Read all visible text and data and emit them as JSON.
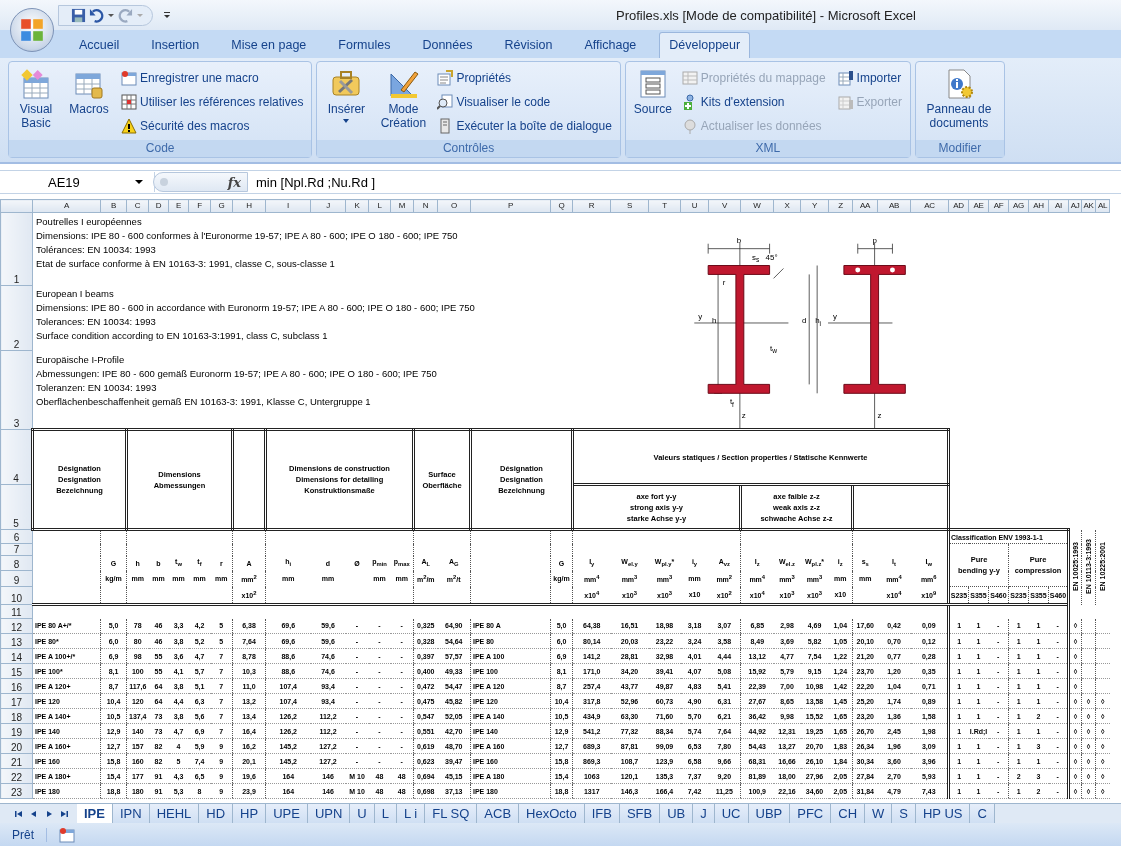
{
  "window": {
    "title": "Profiles.xls  [Mode de compatibilité] - Microsoft Excel"
  },
  "ribbon_tabs": [
    {
      "label": "Accueil",
      "selected": false
    },
    {
      "label": "Insertion",
      "selected": false
    },
    {
      "label": "Mise en page",
      "selected": false
    },
    {
      "label": "Formules",
      "selected": false
    },
    {
      "label": "Données",
      "selected": false
    },
    {
      "label": "Révision",
      "selected": false
    },
    {
      "label": "Affichage",
      "selected": false
    },
    {
      "label": "Développeur",
      "selected": true
    }
  ],
  "ribbon_groups": [
    {
      "title": "Code",
      "large": [
        {
          "label": "Visual Basic",
          "disabled": false
        },
        {
          "label": "Macros",
          "disabled": false
        }
      ],
      "small": [
        {
          "label": "Enregistrer une macro",
          "disabled": false
        },
        {
          "label": "Utiliser les références relatives",
          "disabled": false
        },
        {
          "label": "Sécurité des macros",
          "disabled": false
        }
      ]
    },
    {
      "title": "Contrôles",
      "large": [
        {
          "label": "Insérer",
          "disabled": false,
          "dropdown": true
        },
        {
          "label": "Mode Création",
          "disabled": false
        }
      ],
      "small": [
        {
          "label": "Propriétés",
          "disabled": false
        },
        {
          "label": "Visualiser le code",
          "disabled": false
        },
        {
          "label": "Exécuter la boîte de dialogue",
          "disabled": false
        }
      ]
    },
    {
      "title": "XML",
      "large": [
        {
          "label": "Source",
          "disabled": false
        }
      ],
      "small": [
        {
          "label": "Propriétés du mappage",
          "disabled": true
        },
        {
          "label": "Kits d'extension",
          "disabled": false
        },
        {
          "label": "Actualiser les données",
          "disabled": true
        },
        {
          "label": "Importer",
          "disabled": false
        },
        {
          "label": "Exporter",
          "disabled": true
        }
      ]
    },
    {
      "title": "Modifier",
      "large": [
        {
          "label": "Panneau de documents",
          "disabled": false
        }
      ]
    }
  ],
  "formula_bar": {
    "name_box": "AE19",
    "function_label": "fx",
    "formula": "min [Npl.Rd ;Nu.Rd ]"
  },
  "column_headers": [
    "A",
    "B",
    "C",
    "D",
    "E",
    "F",
    "G",
    "H",
    "I",
    "J",
    "K",
    "L",
    "M",
    "N",
    "O",
    "P",
    "Q",
    "R",
    "S",
    "T",
    "U",
    "V",
    "W",
    "X",
    "Y",
    "Z",
    "AA",
    "AB",
    "AC",
    "AD",
    "AE",
    "AF",
    "AG",
    "AH",
    "AI",
    "AJ",
    "AK",
    "AL"
  ],
  "intro": [
    {
      "row": "1",
      "lines": [
        "Poutrelles I européennes",
        "Dimensions: IPE 80 - 600 conformes à l'Euronorme 19-57; IPE A 80 - 600; IPE O 180 - 600; IPE 750",
        "Tolérances: EN 10034: 1993",
        "Etat de surface conforme à EN 10163-3: 1991, classe C, sous-classe 1"
      ]
    },
    {
      "row": "2",
      "lines": [
        "European I beams",
        "Dimensions: IPE 80 - 600 in accordance with Euronorm 19-57; IPE A 80 - 600; IPE O 180 - 600; IPE 750",
        "Tolerances: EN 10034: 1993",
        "Surface condition according to EN 10163-3:1991, class C, subclass 1"
      ]
    },
    {
      "row": "3",
      "lines": [
        "Europäische I-Profile",
        "Abmessungen: IPE 80 - 600 gemäß Euronorm 19-57; IPE A 80 - 600; IPE O 180 - 600; IPE 750",
        "Toleranzen: EN 10034: 1993",
        "Oberflächenbeschaffenheit gemäß EN 10163-3: 1991, Klasse C, Untergruppe 1"
      ]
    }
  ],
  "drawing_labels": [
    "b",
    "s$_{s}$",
    "45°",
    "r",
    "h",
    "y",
    "d",
    "h$_{i}$",
    "t$_{w}$",
    "t$_{f}$",
    "z",
    "p",
    "y",
    "z"
  ],
  "header_row_numbers": [
    "4",
    "5",
    "6",
    "7",
    "8",
    "9",
    "10",
    "11"
  ],
  "table_header": {
    "blocks": [
      {
        "lines": [
          "Désignation",
          "Designation",
          "Bezeichnung"
        ]
      },
      {
        "lines": [
          "Dimensions",
          "Abmessungen"
        ]
      },
      {
        "lines": [
          "Dimensions de construction",
          "Dimensions for detailing",
          "Konstruktionsmaße"
        ]
      },
      {
        "lines": [
          "Surface",
          "Oberfläche"
        ]
      },
      {
        "lines": [
          "Désignation",
          "Designation",
          "Bezeichnung"
        ]
      }
    ],
    "properties_title": "Valeurs statiques / Section properties / Statische Kennwerte",
    "axes": [
      {
        "lines": [
          "axe fort y-y",
          "strong axis y-y",
          "starke Achse y-y"
        ]
      },
      {
        "lines": [
          "axe faible z-z",
          "weak axis z-z",
          "schwache Achse z-z"
        ]
      }
    ],
    "columns": [
      {},
      {
        "symbol": "G",
        "unit": "kg/m"
      },
      {
        "symbol": "h",
        "unit": "mm"
      },
      {
        "symbol": "b",
        "unit": "mm"
      },
      {
        "symbol": "t$_{w}$",
        "unit": "mm"
      },
      {
        "symbol": "t$_{f}$",
        "unit": "mm"
      },
      {
        "symbol": "r",
        "unit": "mm"
      },
      {
        "symbol": "A",
        "unit": "mm$^{2}$",
        "multiplier": "x10$^{2}$"
      },
      {
        "symbol": "h$_{i}$",
        "unit": "mm"
      },
      {
        "symbol": "d",
        "unit": "mm"
      },
      {
        "symbol": "Ø"
      },
      {
        "symbol": "p$_{min}$",
        "unit": "mm"
      },
      {
        "symbol": "p$_{max}$",
        "unit": "mm"
      },
      {
        "symbol": "A$_{L}$",
        "unit": "m$^{2}$/m"
      },
      {
        "symbol": "A$_{G}$",
        "unit": "m$^{2}$/t"
      },
      {},
      {
        "symbol": "G",
        "unit": "kg/m"
      },
      {
        "symbol": "I$_{y}$",
        "unit": "mm$^{4}$",
        "multiplier": "x10$^{4}$"
      },
      {
        "symbol": "W$_{el.y}$",
        "unit": "mm$^{3}$",
        "multiplier": "x10$^{3}$"
      },
      {
        "symbol": "W$_{pl.y}$*",
        "unit": "mm$^{3}$",
        "multiplier": "x10$^{3}$"
      },
      {
        "symbol": "i$_{y}$",
        "unit": "mm",
        "multiplier": "x10"
      },
      {
        "symbol": "A$_{vz}$",
        "unit": "mm$^{2}$",
        "multiplier": "x10$^{2}$"
      },
      {
        "symbol": "I$_{z}$",
        "unit": "mm$^{4}$",
        "multiplier": "x10$^{4}$"
      },
      {
        "symbol": "W$_{el.z}$",
        "unit": "mm$^{3}$",
        "multiplier": "x10$^{3}$"
      },
      {
        "symbol": "W$_{pl.z}$*",
        "unit": "mm$^{3}$",
        "multiplier": "x10$^{3}$"
      },
      {
        "symbol": "i$_{z}$",
        "unit": "mm",
        "multiplier": "x10"
      },
      {
        "symbol": "s$_{s}$",
        "unit": "mm"
      },
      {
        "symbol": "I$_{t}$",
        "unit": "mm$^{4}$",
        "multiplier": "x10$^{4}$"
      },
      {
        "symbol": "I$_{w}$",
        "unit": "mm$^{6}$",
        "multiplier": "x10$^{9}$"
      }
    ],
    "classification": {
      "title": "Classification ENV 1993-1-1",
      "groups": [
        {
          "lines": [
            "Pure",
            "bending y-y"
          ]
        },
        {
          "lines": [
            "Pure",
            "compression"
          ]
        }
      ],
      "grades": [
        "S235",
        "S355",
        "S460",
        "S235",
        "S355",
        "S460"
      ]
    },
    "standards": [
      "EN 10025:1993",
      "EN 10113-3:1993",
      "EN 10225:2001"
    ]
  },
  "rows": [
    {
      "number": "12",
      "cells": [
        "IPE 80 A+/*",
        "5,0",
        "78",
        "46",
        "3,3",
        "4,2",
        "5",
        "6,38",
        "69,6",
        "59,6",
        "-",
        "-",
        "-",
        "0,325",
        "64,90",
        "IPE 80 A",
        "5,0",
        "64,38",
        "16,51",
        "18,98",
        "3,18",
        "3,07",
        "6,85",
        "2,98",
        "4,69",
        "1,04",
        "17,60",
        "0,42",
        "0,09"
      ],
      "classes": [
        "1",
        "1",
        "-",
        "1",
        "1",
        "-"
      ],
      "standards": [
        "◊"
      ]
    },
    {
      "number": "13",
      "cells": [
        "IPE 80*",
        "6,0",
        "80",
        "46",
        "3,8",
        "5,2",
        "5",
        "7,64",
        "69,6",
        "59,6",
        "-",
        "-",
        "-",
        "0,328",
        "54,64",
        "IPE 80",
        "6,0",
        "80,14",
        "20,03",
        "23,22",
        "3,24",
        "3,58",
        "8,49",
        "3,69",
        "5,82",
        "1,05",
        "20,10",
        "0,70",
        "0,12"
      ],
      "classes": [
        "1",
        "1",
        "-",
        "1",
        "1",
        "-"
      ],
      "standards": [
        "◊"
      ]
    },
    {
      "number": "14",
      "cells": [
        "IPE A 100+/*",
        "6,9",
        "98",
        "55",
        "3,6",
        "4,7",
        "7",
        "8,78",
        "88,6",
        "74,6",
        "-",
        "-",
        "-",
        "0,397",
        "57,57",
        "IPE A 100",
        "6,9",
        "141,2",
        "28,81",
        "32,98",
        "4,01",
        "4,44",
        "13,12",
        "4,77",
        "7,54",
        "1,22",
        "21,20",
        "0,77",
        "0,28"
      ],
      "classes": [
        "1",
        "1",
        "-",
        "1",
        "1",
        "-"
      ],
      "standards": [
        "◊"
      ]
    },
    {
      "number": "15",
      "cells": [
        "IPE 100*",
        "8,1",
        "100",
        "55",
        "4,1",
        "5,7",
        "7",
        "10,3",
        "88,6",
        "74,6",
        "-",
        "-",
        "-",
        "0,400",
        "49,33",
        "IPE 100",
        "8,1",
        "171,0",
        "34,20",
        "39,41",
        "4,07",
        "5,08",
        "15,92",
        "5,79",
        "9,15",
        "1,24",
        "23,70",
        "1,20",
        "0,35"
      ],
      "classes": [
        "1",
        "1",
        "-",
        "1",
        "1",
        "-"
      ],
      "standards": [
        "◊"
      ]
    },
    {
      "number": "16",
      "cells": [
        "IPE A 120+",
        "8,7",
        "117,6",
        "64",
        "3,8",
        "5,1",
        "7",
        "11,0",
        "107,4",
        "93,4",
        "-",
        "-",
        "-",
        "0,472",
        "54,47",
        "IPE A 120",
        "8,7",
        "257,4",
        "43,77",
        "49,87",
        "4,83",
        "5,41",
        "22,39",
        "7,00",
        "10,98",
        "1,42",
        "22,20",
        "1,04",
        "0,71"
      ],
      "classes": [
        "1",
        "1",
        "-",
        "1",
        "1",
        "-"
      ],
      "standards": [
        "◊"
      ]
    },
    {
      "number": "17",
      "cells": [
        "IPE 120",
        "10,4",
        "120",
        "64",
        "4,4",
        "6,3",
        "7",
        "13,2",
        "107,4",
        "93,4",
        "-",
        "-",
        "-",
        "0,475",
        "45,82",
        "IPE 120",
        "10,4",
        "317,8",
        "52,96",
        "60,73",
        "4,90",
        "6,31",
        "27,67",
        "8,65",
        "13,58",
        "1,45",
        "25,20",
        "1,74",
        "0,89"
      ],
      "classes": [
        "1",
        "1",
        "-",
        "1",
        "1",
        "-"
      ],
      "standards": [
        "◊",
        "◊",
        "◊"
      ]
    },
    {
      "number": "18",
      "cells": [
        "IPE A 140+",
        "10,5",
        "137,4",
        "73",
        "3,8",
        "5,6",
        "7",
        "13,4",
        "126,2",
        "112,2",
        "-",
        "-",
        "-",
        "0,547",
        "52,05",
        "IPE A 140",
        "10,5",
        "434,9",
        "63,30",
        "71,60",
        "5,70",
        "6,21",
        "36,42",
        "9,98",
        "15,52",
        "1,65",
        "23,20",
        "1,36",
        "1,58"
      ],
      "classes": [
        "1",
        "1",
        "-",
        "1",
        "2",
        "-"
      ],
      "standards": [
        "◊",
        "◊",
        "◊"
      ]
    },
    {
      "number": "19",
      "cells": [
        "IPE 140",
        "12,9",
        "140",
        "73",
        "4,7",
        "6,9",
        "7",
        "16,4",
        "126,2",
        "112,2",
        "-",
        "-",
        "-",
        "0,551",
        "42,70",
        "IPE 140",
        "12,9",
        "541,2",
        "77,32",
        "88,34",
        "5,74",
        "7,64",
        "44,92",
        "12,31",
        "19,25",
        "1,65",
        "26,70",
        "2,45",
        "1,98"
      ],
      "classes": [
        "1",
        "I.Rd;I",
        "-",
        "1",
        "1",
        "-"
      ],
      "standards": [
        "◊",
        "◊",
        "◊"
      ]
    },
    {
      "number": "20",
      "cells": [
        "IPE A 160+",
        "12,7",
        "157",
        "82",
        "4",
        "5,9",
        "9",
        "16,2",
        "145,2",
        "127,2",
        "-",
        "-",
        "-",
        "0,619",
        "48,70",
        "IPE A 160",
        "12,7",
        "689,3",
        "87,81",
        "99,09",
        "6,53",
        "7,80",
        "54,43",
        "13,27",
        "20,70",
        "1,83",
        "26,34",
        "1,96",
        "3,09"
      ],
      "classes": [
        "1",
        "1",
        "-",
        "1",
        "3",
        "-"
      ],
      "standards": [
        "◊",
        "◊",
        "◊"
      ]
    },
    {
      "number": "21",
      "cells": [
        "IPE 160",
        "15,8",
        "160",
        "82",
        "5",
        "7,4",
        "9",
        "20,1",
        "145,2",
        "127,2",
        "-",
        "-",
        "-",
        "0,623",
        "39,47",
        "IPE 160",
        "15,8",
        "869,3",
        "108,7",
        "123,9",
        "6,58",
        "9,66",
        "68,31",
        "16,66",
        "26,10",
        "1,84",
        "30,34",
        "3,60",
        "3,96"
      ],
      "classes": [
        "1",
        "1",
        "-",
        "1",
        "1",
        "-"
      ],
      "standards": [
        "◊",
        "◊",
        "◊"
      ]
    },
    {
      "number": "22",
      "cells": [
        "IPE A 180+",
        "15,4",
        "177",
        "91",
        "4,3",
        "6,5",
        "9",
        "19,6",
        "164",
        "146",
        "M 10",
        "48",
        "48",
        "0,694",
        "45,15",
        "IPE A 180",
        "15,4",
        "1063",
        "120,1",
        "135,3",
        "7,37",
        "9,20",
        "81,89",
        "18,00",
        "27,96",
        "2,05",
        "27,84",
        "2,70",
        "5,93"
      ],
      "classes": [
        "1",
        "1",
        "-",
        "2",
        "3",
        "-"
      ],
      "standards": [
        "◊",
        "◊",
        "◊"
      ]
    },
    {
      "number": "23",
      "cells": [
        "IPE 180",
        "18,8",
        "180",
        "91",
        "5,3",
        "8",
        "9",
        "23,9",
        "164",
        "146",
        "M 10",
        "48",
        "48",
        "0,698",
        "37,13",
        "IPE 180",
        "18,8",
        "1317",
        "146,3",
        "166,4",
        "7,42",
        "11,25",
        "100,9",
        "22,16",
        "34,60",
        "2,05",
        "31,84",
        "4,79",
        "7,43"
      ],
      "classes": [
        "1",
        "1",
        "-",
        "1",
        "2",
        "-"
      ],
      "standards": [
        "◊",
        "◊",
        "◊"
      ]
    }
  ],
  "sheet_tabs": [
    {
      "label": "IPE",
      "selected": true
    },
    {
      "label": "IPN",
      "selected": false
    },
    {
      "label": "HEHL",
      "selected": false
    },
    {
      "label": "HD",
      "selected": false
    },
    {
      "label": "HP",
      "selected": false
    },
    {
      "label": "UPE",
      "selected": false
    },
    {
      "label": "UPN",
      "selected": false
    },
    {
      "label": "U",
      "selected": false
    },
    {
      "label": "L",
      "selected": false
    },
    {
      "label": "L i",
      "selected": false
    },
    {
      "label": "FL SQ",
      "selected": false
    },
    {
      "label": "ACB",
      "selected": false
    },
    {
      "label": "HexOcto",
      "selected": false
    },
    {
      "label": "IFB",
      "selected": false
    },
    {
      "label": "SFB",
      "selected": false
    },
    {
      "label": "UB",
      "selected": false
    },
    {
      "label": "J",
      "selected": false
    },
    {
      "label": "UC",
      "selected": false
    },
    {
      "label": "UBP",
      "selected": false
    },
    {
      "label": "PFC",
      "selected": false
    },
    {
      "label": "CH",
      "selected": false
    },
    {
      "label": "W",
      "selected": false
    },
    {
      "label": "S",
      "selected": false
    },
    {
      "label": "HP US",
      "selected": false
    },
    {
      "label": "C",
      "selected": false
    }
  ],
  "status_bar": {
    "text": "Prêt"
  }
}
